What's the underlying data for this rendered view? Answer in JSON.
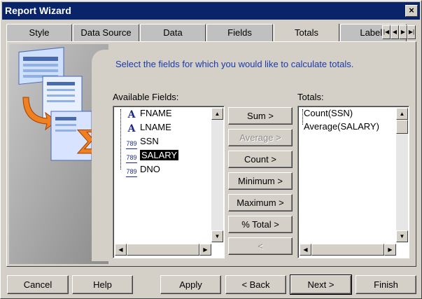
{
  "window": {
    "title": "Report Wizard",
    "close_label": "×"
  },
  "tabs": [
    {
      "label": "Style"
    },
    {
      "label": "Data Source"
    },
    {
      "label": "Data"
    },
    {
      "label": "Fields"
    },
    {
      "label": "Totals",
      "active": true
    },
    {
      "label": "Labels"
    }
  ],
  "tab_scroll": {
    "first": "|◀",
    "prev": "◀",
    "next": "▶",
    "last": "▶|"
  },
  "panel": {
    "instruction": "Select the fields for which you would like to calculate totals.",
    "available_label": "Available Fields:",
    "totals_label": "Totals:"
  },
  "available_fields": [
    {
      "name": "FNAME",
      "type_icon": "text-field-icon",
      "icon_glyph": "A",
      "selected": false
    },
    {
      "name": "LNAME",
      "type_icon": "text-field-icon",
      "icon_glyph": "A",
      "selected": false
    },
    {
      "name": "SSN",
      "type_icon": "number-field-icon",
      "icon_glyph": "789",
      "selected": false
    },
    {
      "name": "SALARY",
      "type_icon": "number-field-icon",
      "icon_glyph": "789",
      "selected": true
    },
    {
      "name": "DNO",
      "type_icon": "number-field-icon",
      "icon_glyph": "789",
      "selected": false
    }
  ],
  "totals_list": [
    "Count(SSN)",
    "Average(SALARY)"
  ],
  "total_buttons": [
    {
      "label": "Sum  >",
      "enabled": true
    },
    {
      "label": "Average >",
      "enabled": false
    },
    {
      "label": "Count  >",
      "enabled": true
    },
    {
      "label": "Minimum >",
      "enabled": true
    },
    {
      "label": "Maximum >",
      "enabled": true
    },
    {
      "label": "% Total >",
      "enabled": true
    },
    {
      "label": "<",
      "enabled": false
    }
  ],
  "scroll_glyphs": {
    "up": "▲",
    "down": "▼",
    "left": "◀",
    "right": "▶"
  },
  "footer": {
    "cancel": "Cancel",
    "help": "Help",
    "apply": "Apply",
    "back": "< Back",
    "next": "Next >",
    "finish": "Finish"
  },
  "colors": {
    "title_bar": "#0a246a",
    "instruction_text": "#1c3aa8",
    "face": "#d4d0c8"
  }
}
